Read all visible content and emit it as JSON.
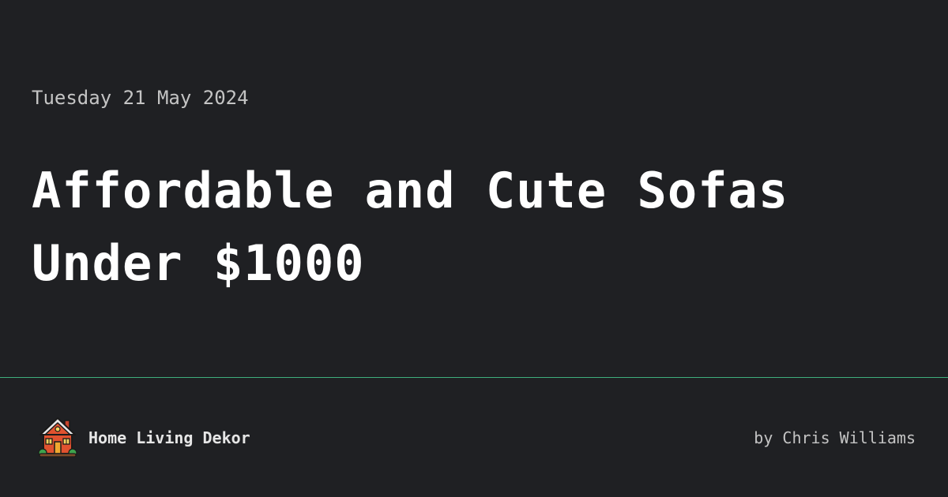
{
  "post": {
    "date": "Tuesday 21 May 2024",
    "title": "Affordable and Cute Sofas Under $1000"
  },
  "footer": {
    "brand_name": "Home Living Dekor",
    "brand_icon": "house-icon",
    "author": "by Chris Williams"
  },
  "colors": {
    "background": "#1f2023",
    "divider": "#3fae7c",
    "title": "#ffffff",
    "muted_text": "#c4c4c4"
  }
}
